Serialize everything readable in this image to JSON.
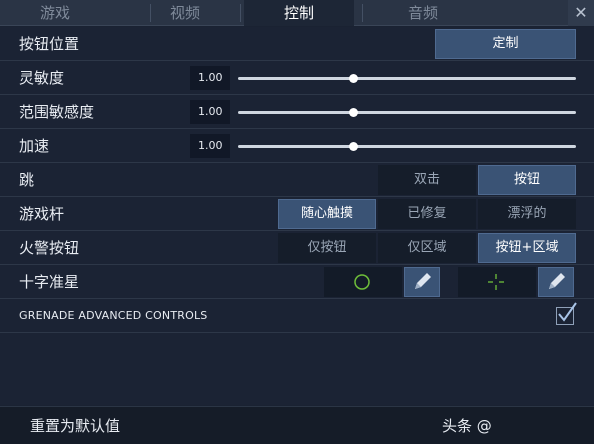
{
  "tabs": [
    "游戏",
    "视频",
    "控制",
    "音频"
  ],
  "active_tab": 2,
  "close_glyph": "✕",
  "rows": {
    "button_position": {
      "label": "按钮位置",
      "button": "定制"
    },
    "sensitivity": {
      "label": "灵敏度",
      "value": "1.00",
      "level": 0.34
    },
    "range_sensitivity": {
      "label": "范围敏感度",
      "value": "1.00",
      "level": 0.34
    },
    "acceleration": {
      "label": "加速",
      "value": "1.00",
      "level": 0.34
    },
    "jump": {
      "label": "跳",
      "options": [
        "双击",
        "按钮"
      ],
      "selected": 1
    },
    "joystick": {
      "label": "游戏杆",
      "options": [
        "随心触摸",
        "已修复",
        "漂浮的"
      ],
      "selected": 0
    },
    "fire_button": {
      "label": "火警按钮",
      "options": [
        "仅按钮",
        "仅区域",
        "按钮+区域"
      ],
      "selected": 2
    },
    "crosshair": {
      "label": "十字准星",
      "icons": [
        "circle-crosshair-icon",
        "pencil-icon",
        "cross-crosshair-icon",
        "pencil-icon"
      ]
    },
    "grenade": {
      "label": "GRENADE ADVANCED CONTROLS",
      "checked": true
    }
  },
  "footer": {
    "reset_label": "重置为默认值",
    "right_text": "头条 @"
  },
  "colors": {
    "selected_bg": "#3a5375",
    "crosshair_green": "#6fbf3a",
    "panel_bg": "#1b2334"
  }
}
